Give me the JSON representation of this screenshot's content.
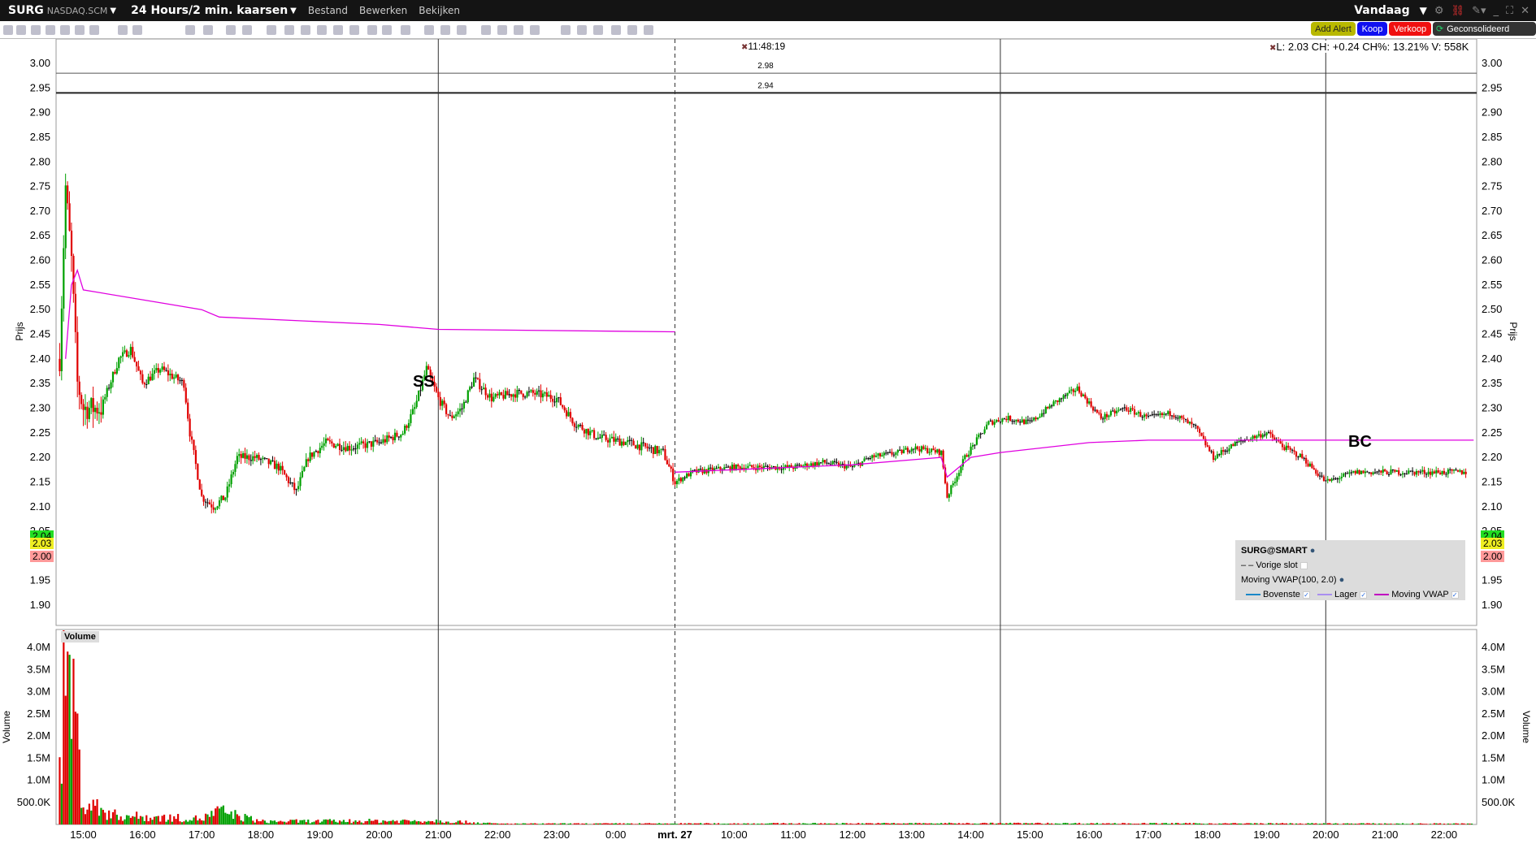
{
  "titlebar": {
    "symbol": "SURG",
    "exchange": "NASDAQ.SCM",
    "chart_title": "24 Hours/2 min. kaarsen",
    "menus": [
      "Bestand",
      "Bewerken",
      "Bekijken"
    ],
    "period": "Vandaag"
  },
  "actions": {
    "add_alert": "Add Alert",
    "buy": "Koop",
    "sell": "Verkoop",
    "consolidated": "Geconsolideerd"
  },
  "info": {
    "crosshair_time": "11:48:19",
    "quote": "L: 2.03 CH: +0.24 CH%: 13.21% V: 558K"
  },
  "legend": {
    "title": "SURG@SMART",
    "prev_close": "Vorige slot",
    "indicator": "Moving VWAP(100, 2.0)",
    "upper": "Bovenste",
    "lower": "Lager",
    "vwap": "Moving VWAP"
  },
  "markers": {
    "ss": "SS",
    "bc": "BC"
  },
  "price_tags": {
    "a": "2.04",
    "b": "2.03",
    "c": "2.00"
  },
  "colors": {
    "up": "#00a000",
    "down": "#e00000",
    "vwap": "#e000e0",
    "upper": "#1a88c8",
    "lower": "#a98ff0"
  },
  "chart_data": [
    {
      "type": "candlestick",
      "ylabel": "Prijs",
      "ylim": [
        1.87,
        3.02
      ],
      "yticks": [
        "3.00",
        "2.95",
        "2.90",
        "2.85",
        "2.80",
        "2.75",
        "2.70",
        "2.65",
        "2.60",
        "2.55",
        "2.50",
        "2.45",
        "2.40",
        "2.35",
        "2.30",
        "2.25",
        "2.20",
        "2.15",
        "2.10",
        "2.05",
        "2.00",
        "1.95",
        "1.90"
      ],
      "xticks": [
        "15:00",
        "16:00",
        "17:00",
        "18:00",
        "19:00",
        "20:00",
        "21:00",
        "22:00",
        "23:00",
        "0:00",
        "mrt. 27",
        "10:00",
        "11:00",
        "12:00",
        "13:00",
        "14:00",
        "15:00",
        "16:00",
        "17:00",
        "18:00",
        "19:00",
        "20:00",
        "21:00",
        "22:00"
      ],
      "hlines": [
        {
          "value": 2.98,
          "label": "2.98"
        },
        {
          "value": 2.94,
          "label": "2.94"
        }
      ],
      "vlines_hour_index": [
        6,
        10,
        15.5,
        21
      ],
      "price_path": [
        [
          -0.4,
          2.4
        ],
        [
          -0.3,
          2.75
        ],
        [
          -0.2,
          2.6
        ],
        [
          -0.1,
          2.35
        ],
        [
          0,
          2.3
        ],
        [
          0.3,
          2.3
        ],
        [
          0.6,
          2.4
        ],
        [
          0.8,
          2.42
        ],
        [
          1.0,
          2.35
        ],
        [
          1.3,
          2.38
        ],
        [
          1.7,
          2.35
        ],
        [
          1.8,
          2.25
        ],
        [
          2.0,
          2.12
        ],
        [
          2.2,
          2.1
        ],
        [
          2.4,
          2.12
        ],
        [
          2.6,
          2.2
        ],
        [
          2.9,
          2.2
        ],
        [
          3.3,
          2.18
        ],
        [
          3.6,
          2.13
        ],
        [
          3.8,
          2.2
        ],
        [
          4.1,
          2.23
        ],
        [
          4.5,
          2.22
        ],
        [
          5.0,
          2.23
        ],
        [
          5.4,
          2.25
        ],
        [
          5.6,
          2.3
        ],
        [
          5.8,
          2.38
        ],
        [
          6.0,
          2.32
        ],
        [
          6.2,
          2.28
        ],
        [
          6.4,
          2.3
        ],
        [
          6.6,
          2.36
        ],
        [
          6.9,
          2.32
        ],
        [
          7.3,
          2.33
        ],
        [
          7.6,
          2.33
        ],
        [
          8.0,
          2.32
        ],
        [
          8.3,
          2.27
        ],
        [
          8.7,
          2.24
        ],
        [
          9.2,
          2.23
        ],
        [
          9.8,
          2.21
        ],
        [
          10.0,
          2.15
        ],
        [
          10.3,
          2.17
        ],
        [
          11,
          2.18
        ],
        [
          12,
          2.18
        ],
        [
          12.5,
          2.19
        ],
        [
          13,
          2.18
        ],
        [
          13.3,
          2.2
        ],
        [
          13.8,
          2.21
        ],
        [
          14.0,
          2.22
        ],
        [
          14.5,
          2.21
        ],
        [
          14.6,
          2.12
        ],
        [
          14.9,
          2.2
        ],
        [
          15.3,
          2.27
        ],
        [
          15.6,
          2.28
        ],
        [
          16,
          2.27
        ],
        [
          16.4,
          2.31
        ],
        [
          16.8,
          2.34
        ],
        [
          17.2,
          2.28
        ],
        [
          17.6,
          2.3
        ],
        [
          18,
          2.28
        ],
        [
          18.4,
          2.29
        ],
        [
          18.8,
          2.26
        ],
        [
          19.1,
          2.2
        ],
        [
          19.5,
          2.23
        ],
        [
          20,
          2.25
        ],
        [
          20.3,
          2.22
        ],
        [
          20.6,
          2.2
        ],
        [
          21.0,
          2.15
        ],
        [
          21.5,
          2.17
        ],
        [
          22.5,
          2.17
        ],
        [
          23.4,
          2.17
        ]
      ],
      "vwap_day1": [
        [
          -0.3,
          2.4
        ],
        [
          -0.2,
          2.55
        ],
        [
          -0.1,
          2.58
        ],
        [
          0,
          2.54
        ],
        [
          1.5,
          2.51
        ],
        [
          2.0,
          2.5
        ],
        [
          2.3,
          2.485
        ],
        [
          5,
          2.47
        ],
        [
          6,
          2.46
        ],
        [
          10,
          2.455
        ]
      ],
      "vwap_day2": [
        [
          10,
          2.17
        ],
        [
          11,
          2.175
        ],
        [
          13,
          2.185
        ],
        [
          14.5,
          2.2
        ],
        [
          14.6,
          2.16
        ],
        [
          15,
          2.2
        ],
        [
          15.5,
          2.21
        ],
        [
          17,
          2.23
        ],
        [
          18,
          2.235
        ],
        [
          23.5,
          2.235
        ]
      ]
    },
    {
      "type": "bar",
      "ylabel": "Volume",
      "title": "Volume",
      "yticks": [
        "4.0M",
        "3.5M",
        "3.0M",
        "2.5M",
        "2.0M",
        "1.5M",
        "1.0M",
        "500.0K"
      ],
      "ylim": [
        0,
        4.3
      ],
      "volume_profile_millions": [
        [
          -0.4,
          2.5
        ],
        [
          -0.3,
          3.5
        ],
        [
          -0.2,
          4.1
        ],
        [
          -0.1,
          2.0
        ],
        [
          0,
          0.6
        ],
        [
          0.5,
          0.25
        ],
        [
          1,
          0.2
        ],
        [
          2,
          0.15
        ],
        [
          2.3,
          0.35
        ],
        [
          3,
          0.08
        ],
        [
          6,
          0.1
        ],
        [
          7,
          0.02
        ],
        [
          15.5,
          0.03
        ],
        [
          23.5,
          0.02
        ]
      ]
    }
  ]
}
